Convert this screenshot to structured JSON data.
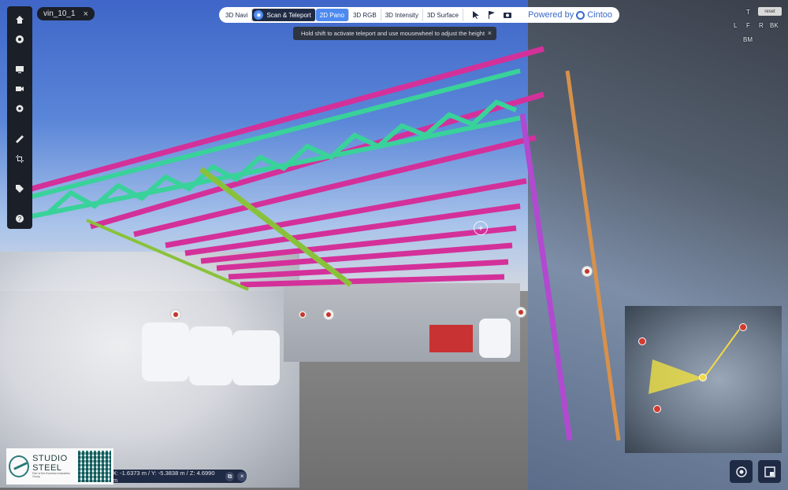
{
  "project": {
    "name": "vin_10_1",
    "close_glyph": "×"
  },
  "modebar": {
    "items": [
      {
        "label": "3D Navi"
      },
      {
        "label": "Scan & Teleport"
      },
      {
        "label": "2D Pano"
      },
      {
        "label": "3D RGB"
      },
      {
        "label": "3D Intensity"
      },
      {
        "label": "3D Surface"
      }
    ],
    "active": "2D Pano",
    "powered_label": "Powered by",
    "brand": "Cintoo",
    "teleport_glyph": "◉"
  },
  "hint": {
    "text": "Hold shift to activate teleport and use mousewheel to adjust the height",
    "close_glyph": "×"
  },
  "viewcube": {
    "top": "T",
    "left": "L",
    "front": "F",
    "right": "R",
    "back": "BK",
    "bottom": "BM",
    "reset": "reset"
  },
  "coords": {
    "text": "X: -1.6373 m / Y: -5.3838 m / Z: 4.6990 m",
    "copy_glyph": "⧉",
    "close_glyph": "×"
  },
  "logo": {
    "line1": "STUDIO",
    "line2": "STEEL",
    "line3": "Part of the Evolution Industries Group"
  },
  "crosshair_glyph": "+",
  "icons": {
    "left_toolbar": [
      "home-icon",
      "eye-icon",
      "screen-icon",
      "camera-move-icon",
      "settings-icon",
      "ruler-icon",
      "crop-icon",
      "tag-icon",
      "help-icon"
    ],
    "modebar": [
      "cursor-icon",
      "flag-icon",
      "camera-icon"
    ],
    "bottom_right": [
      "orbit-icon",
      "minimap-toggle-icon"
    ]
  },
  "colors": {
    "accent": "#4d8af0",
    "toolbar_bg": "#1b1f27",
    "panel_dark": "#1f2a44",
    "marker": "#c4372c",
    "brand": "#3a69c9"
  }
}
